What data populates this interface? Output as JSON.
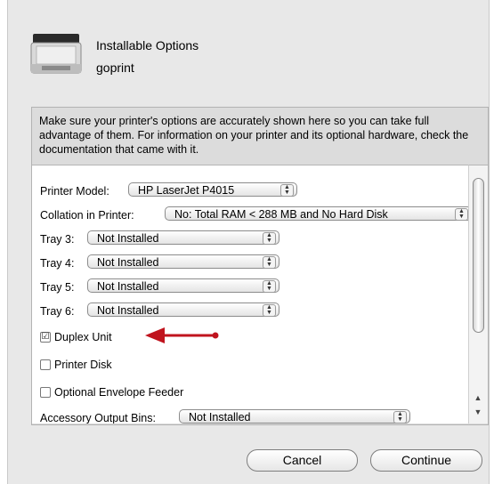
{
  "dialog": {
    "title": "Installable Options",
    "subtitle": "goprint",
    "description": "Make sure your printer's options are accurately shown here so you can take full advantage of them.  For information on your printer and its optional hardware, check the documentation that came with it."
  },
  "options": {
    "printer_model": {
      "label": "Printer Model:",
      "value": "HP LaserJet P4015"
    },
    "collation": {
      "label": "Collation in Printer:",
      "value": "No: Total RAM <  288 MB and No Hard Disk"
    },
    "tray3": {
      "label": "Tray 3:",
      "value": "Not Installed"
    },
    "tray4": {
      "label": "Tray 4:",
      "value": "Not Installed"
    },
    "tray5": {
      "label": "Tray 5:",
      "value": "Not Installed"
    },
    "tray6": {
      "label": "Tray 6:",
      "value": "Not Installed"
    },
    "duplex": {
      "label": "Duplex Unit",
      "checked": true,
      "mark": "☑"
    },
    "printer_disk": {
      "label": "Printer Disk",
      "checked": false
    },
    "envelope_feeder": {
      "label": "Optional Envelope Feeder",
      "checked": false
    },
    "output_bins": {
      "label": "Accessory Output Bins:",
      "value": "Not Installed"
    }
  },
  "buttons": {
    "cancel": "Cancel",
    "continue": "Continue"
  },
  "annotation": {
    "arrow_color": "#c0141e"
  },
  "icons": [
    "printer-icon",
    "popup-arrows-icon",
    "checkbox-icon",
    "scroll-up-arrow-icon",
    "scroll-down-arrow-icon",
    "red-arrow-icon"
  ]
}
